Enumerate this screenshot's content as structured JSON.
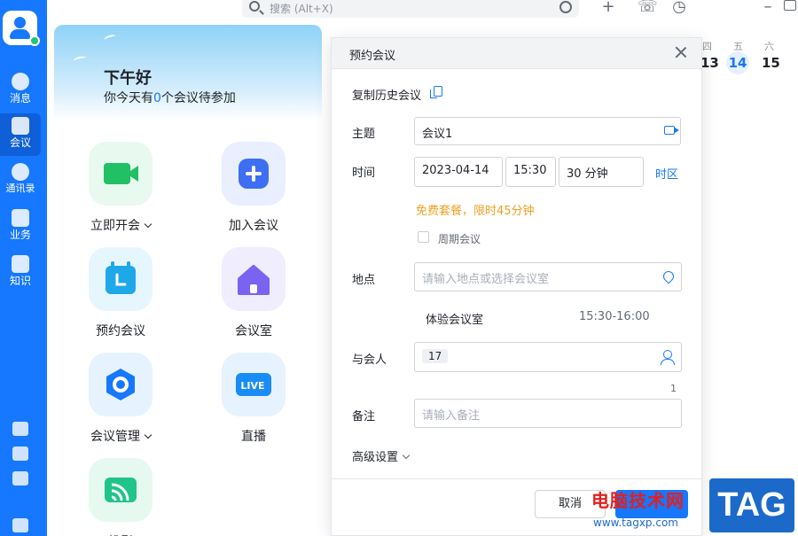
{
  "colors": {
    "accent": "#1677ff",
    "warning": "#f0a020",
    "rail": "#1677ff"
  },
  "rail": {
    "items": [
      {
        "label": "消息",
        "icon": "message-icon"
      },
      {
        "label": "会议",
        "icon": "meeting-icon",
        "active": true
      },
      {
        "label": "通讯录",
        "icon": "contacts-icon"
      },
      {
        "label": "业务",
        "icon": "apps-icon"
      },
      {
        "label": "知识",
        "icon": "knowledge-icon"
      }
    ]
  },
  "search": {
    "placeholder": "搜索 (Alt+X)"
  },
  "home": {
    "greeting": "下午好",
    "sub_prefix": "你今天有",
    "sub_count": "0",
    "sub_suffix": "个会议待参加",
    "tiles": [
      {
        "label": "立即开会",
        "icon": "video-icon",
        "has_chevron": true
      },
      {
        "label": "加入会议",
        "icon": "plus-icon"
      },
      {
        "label": "预约会议",
        "icon": "calendar-icon"
      },
      {
        "label": "会议室",
        "icon": "home-icon"
      },
      {
        "label": "会议管理",
        "icon": "settings-icon",
        "has_chevron": true
      },
      {
        "label": "直播",
        "icon": "live-icon"
      },
      {
        "label": "投影",
        "icon": "cast-icon"
      }
    ],
    "live_badge": "LIVE"
  },
  "calendar": {
    "weekdays": [
      "四",
      "五",
      "六"
    ],
    "days": [
      "13",
      "14",
      "15"
    ],
    "today": "14"
  },
  "dialog": {
    "title": "预约会议",
    "copy_history": "复制历史会议",
    "subject_label": "主题",
    "subject_value": "会议1",
    "time_label": "时间",
    "date_value": "2023-04-14",
    "start_value": "15:30",
    "duration_value": "30 分钟",
    "timezone_link": "时区",
    "notice": "免费套餐，限时45分钟",
    "recurring_label": "周期会议",
    "location_label": "地点",
    "location_placeholder": "请输入地点或选择会议室",
    "room_name": "体验会议室",
    "room_time": "15:30-16:00",
    "attendees_label": "与会人",
    "attendee_chip": "17",
    "attendee_count": "1",
    "notes_label": "备注",
    "notes_placeholder": "请输入备注",
    "advanced_label": "高级设置",
    "cancel_label": "取消"
  },
  "watermark": {
    "text": "电脑技术网",
    "url": "www.tagxp.com",
    "tag": "TAG"
  }
}
